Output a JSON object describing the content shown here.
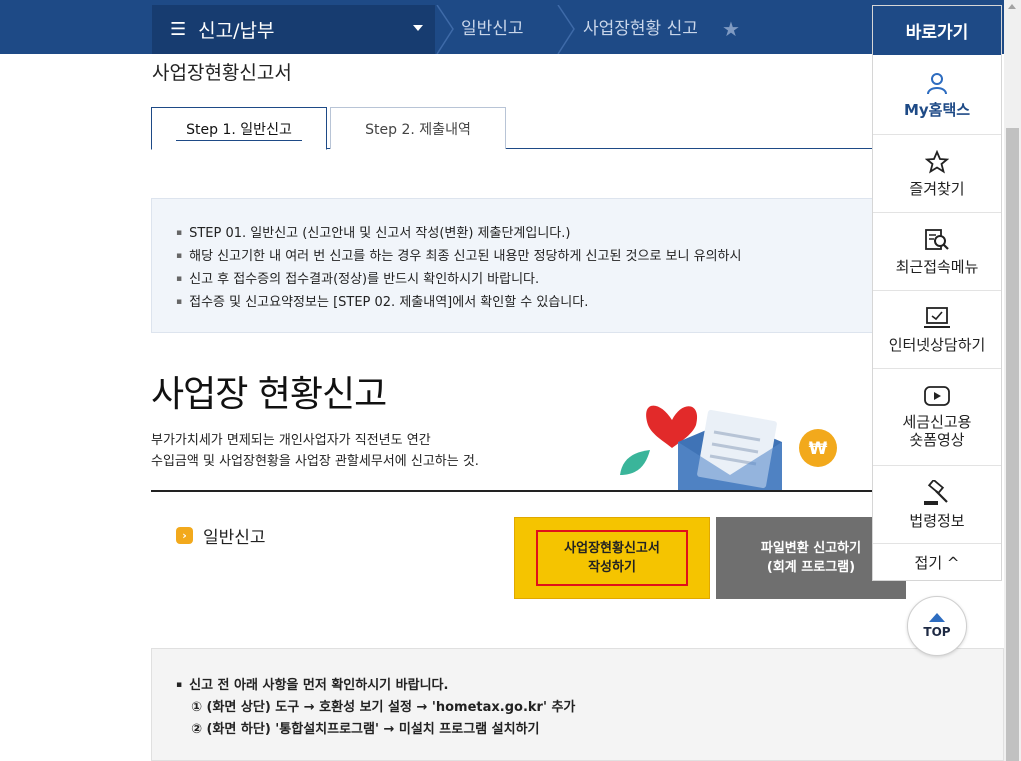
{
  "nav": {
    "menu_title": "신고/납부",
    "breadcrumb": [
      "일반신고",
      "사업장현황 신고"
    ]
  },
  "quick": {
    "title": "바로가기",
    "items": [
      {
        "label": "My홈택스",
        "icon": "person-icon"
      },
      {
        "label": "즐겨찾기",
        "icon": "star-icon"
      },
      {
        "label": "최근접속메뉴",
        "icon": "recent-search-icon"
      },
      {
        "label": "인터넷상담하기",
        "icon": "monitor-chat-icon"
      },
      {
        "label": "세금신고용",
        "label2": "숏폼영상",
        "icon": "play-icon"
      },
      {
        "label": "법령정보",
        "icon": "gavel-icon"
      }
    ],
    "fold": "접기 ^",
    "top": "TOP"
  },
  "page": {
    "heading": "사업장현황신고서",
    "tabs": [
      "Step 1. 일반신고",
      "Step 2. 제출내역"
    ],
    "info": [
      "STEP 01. 일반신고 (신고안내 및 신고서 작성(변환) 제출단계입니다.)",
      "해당 신고기한 내 여러 번 신고를 하는 경우 최종 신고된 내용만 정당하게 신고된 것으로 보니 유의하시",
      "신고 후 접수증의 접수결과(정상)를 반드시 확인하시기 바랍니다.",
      "접수증 및 신고요약정보는 [STEP 02. 제출내역]에서 확인할 수 있습니다."
    ],
    "big_title": "사업장 현황신고",
    "desc1": "부가가치세가 면제되는 개인사업자가 직전년도 연간",
    "desc2": "수입금액 및 사업장현황을 사업장 관할세무서에 신고하는 것.",
    "section_label": "일반신고",
    "btn_write_1": "사업장현황신고서",
    "btn_write_2": "작성하기",
    "btn_convert_1": "파일변환 신고하기",
    "btn_convert_2": "(회계 프로그램)",
    "notice_title": "신고 전 아래 사항을 먼저 확인하시기 바랍니다.",
    "notice_1": "① (화면 상단) 도구 → 호환성 보기 설정 → 'hometax.go.kr' 추가",
    "notice_2": "② (화면 하단) '통합설치프로그램' → 미설치 프로그램 설치하기"
  },
  "colors": {
    "nav": "#1e4a86",
    "yellow_button": "#f5c400",
    "gray_button": "#6f6f6f",
    "highlight_border": "#e0101a"
  }
}
